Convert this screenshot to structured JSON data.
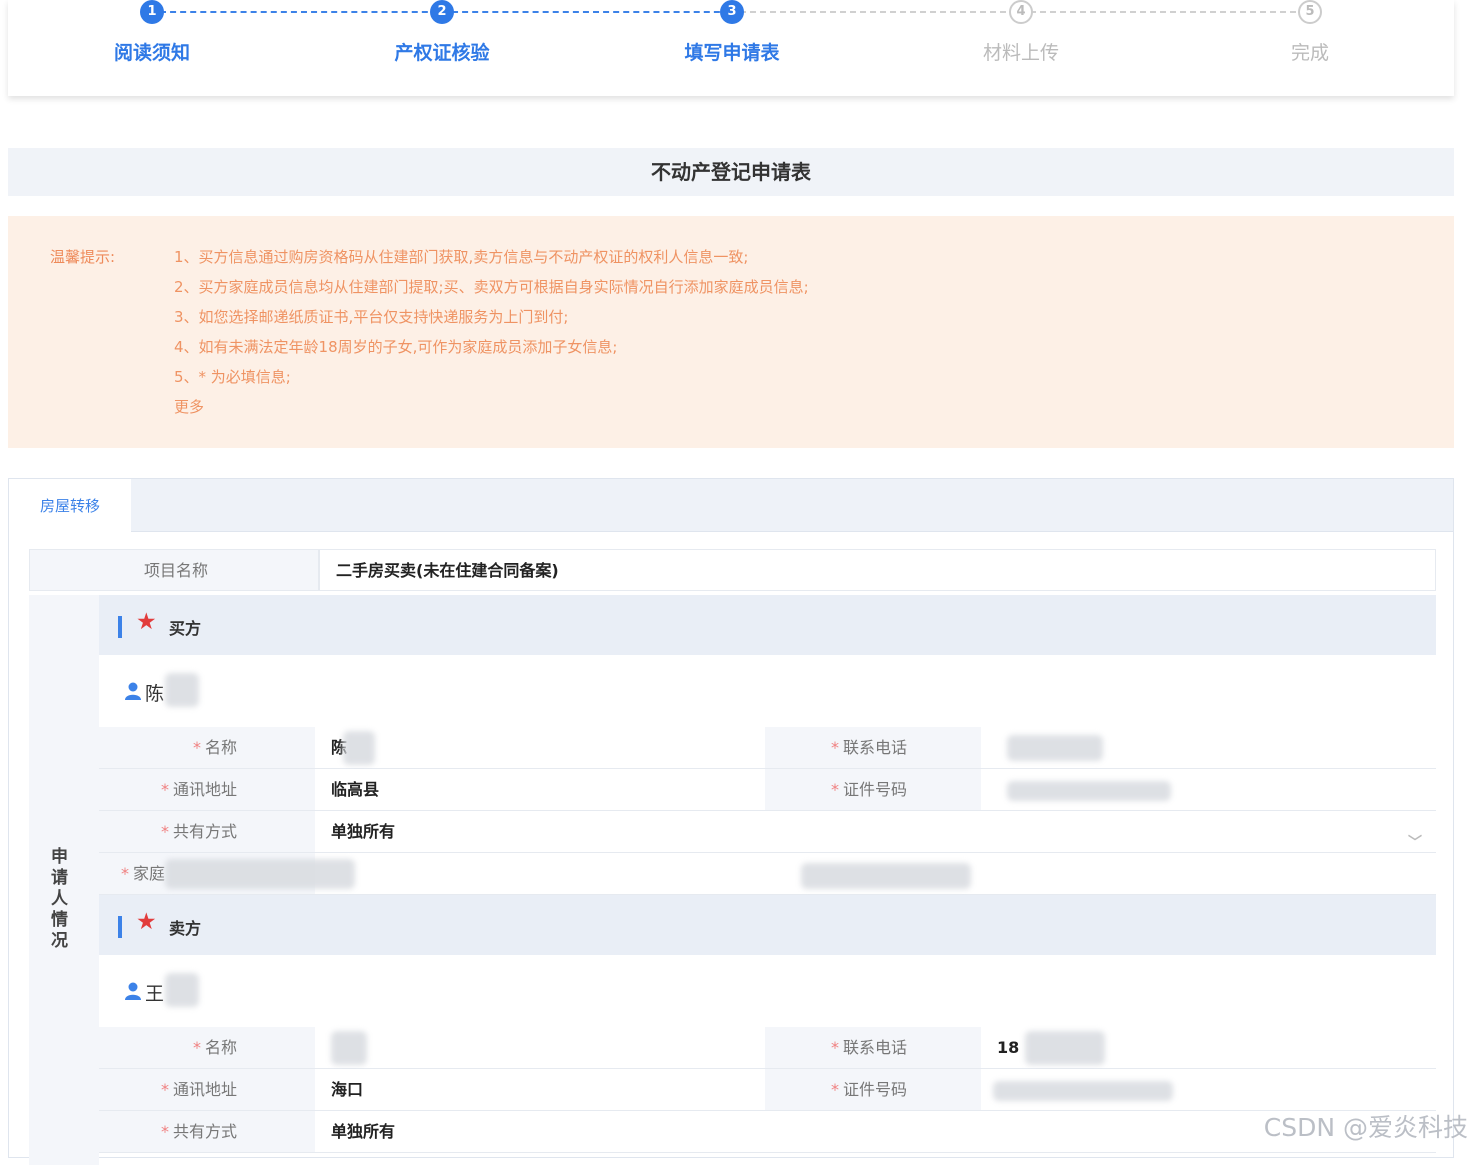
{
  "steps": [
    {
      "num": "1",
      "label": "阅读须知",
      "state": "done"
    },
    {
      "num": "2",
      "label": "产权证核验",
      "state": "done"
    },
    {
      "num": "3",
      "label": "填写申请表",
      "state": "done"
    },
    {
      "num": "4",
      "label": "材料上传",
      "state": "todo"
    },
    {
      "num": "5",
      "label": "完成",
      "state": "todo"
    }
  ],
  "form_title": "不动产登记申请表",
  "tips": {
    "label": "温馨提示:",
    "items": [
      "1、买方信息通过购房资格码从住建部门获取,卖方信息与不动产权证的权利人信息一致;",
      "2、买方家庭成员信息均从住建部门提取;买、卖双方可根据自身实际情况自行添加家庭成员信息;",
      "3、如您选择邮递纸质证书,平台仅支持快递服务为上门到付;",
      "4、如有未满法定年龄18周岁的子女,可作为家庭成员添加子女信息;",
      "5、* 为必填信息;"
    ],
    "more": "更多"
  },
  "tab": {
    "label": "房屋转移"
  },
  "project": {
    "label": "项目名称",
    "value": "二手房买卖(未在住建合同备案)"
  },
  "applicant_section_label": "申请人情况",
  "buyer": {
    "section": "买方",
    "person_name": "陈",
    "fields": {
      "name_label": "名称",
      "name_value": "陈",
      "phone_label": "联系电话",
      "phone_value": "",
      "address_label": "通讯地址",
      "address_value": "临高县",
      "id_label": "证件号码",
      "id_value": "",
      "share_label": "共有方式",
      "share_value": "单独所有",
      "family_label": "家庭"
    }
  },
  "seller": {
    "section": "卖方",
    "person_name": "王",
    "fields": {
      "name_label": "名称",
      "name_value": "",
      "phone_label": "联系电话",
      "phone_value": "18",
      "address_label": "通讯地址",
      "address_value": "海口",
      "id_label": "证件号码",
      "id_value": "",
      "share_label": "共有方式",
      "share_value": "单独所有"
    }
  },
  "watermark": "CSDN @爱炎科技",
  "colors": {
    "accent": "#2f79e6",
    "tip_text": "#ef9363",
    "tip_bg": "#fdf0e6",
    "required_star": "#e23c3c"
  }
}
